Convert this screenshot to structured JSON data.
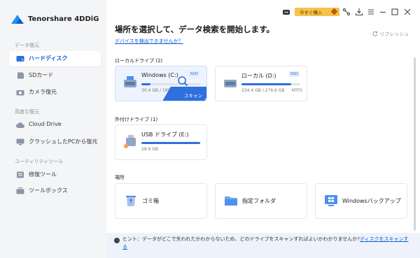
{
  "app": {
    "title": "Tenorshare 4DDiG"
  },
  "sidebar": {
    "sections": [
      {
        "title": "データ復元",
        "items": [
          {
            "label": "ハードディスク",
            "icon": "hard-disk-icon"
          },
          {
            "label": "SDカード",
            "icon": "sd-card-icon"
          },
          {
            "label": "カメラ復元",
            "icon": "camera-icon"
          }
        ]
      },
      {
        "title": "高度な復元",
        "items": [
          {
            "label": "Cloud Drive",
            "icon": "cloud-icon"
          },
          {
            "label": "クラッシュしたPCから復元",
            "icon": "crashed-pc-icon"
          }
        ]
      },
      {
        "title": "ユーティリティツール",
        "items": [
          {
            "label": "修復ツール",
            "icon": "repair-icon"
          },
          {
            "label": "ツールボックス",
            "icon": "toolbox-icon"
          }
        ]
      }
    ],
    "active": "ハードディスク"
  },
  "titlebar": {
    "promo_label": "今すぐ購入"
  },
  "main": {
    "heading": "場所を選択して、データ検索を開始します。",
    "detect_link": "デバイスを検出できませんか？",
    "refresh_label": "リフレッシュ",
    "local_title": "ローカルドライブ (2)",
    "external_title": "外付けドライブ (1)",
    "locations_title": "場所",
    "drives": [
      {
        "name": "Windows (C:)",
        "badge": "SSD",
        "size": "30.4 GB / 199.3 GB",
        "fs": "",
        "used_percent": 15,
        "scan_label": "スキャン"
      },
      {
        "name": "ローカル (D:)",
        "badge": "SSD",
        "size": "234.4 GB / 276.6 GB",
        "fs": "NTFS",
        "used_percent": 85
      }
    ],
    "external": [
      {
        "name": "USB ドライブ (E:)",
        "size": "28.9 GB",
        "used_percent": 100
      }
    ],
    "locations": [
      {
        "label": "ゴミ箱",
        "icon": "recycle-bin-icon"
      },
      {
        "label": "指定フォルダ",
        "icon": "folder-icon"
      },
      {
        "label": "Windowsバックアップ",
        "icon": "windows-backup-icon"
      }
    ],
    "hint_text": "ヒント：データがどこで失われたかわからないため、どのドライブをスキャンすればよいかわかりませんか?",
    "hint_link": "ディスクをスキャンする"
  },
  "colors": {
    "accent": "#2f6fe0",
    "promo": "#f6c24a"
  }
}
